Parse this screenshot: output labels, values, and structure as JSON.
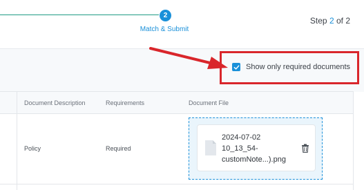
{
  "stepper": {
    "step_number": "2",
    "step_name": "Match & Submit",
    "counter_prefix": "Step ",
    "counter_current": "2",
    "counter_suffix": " of 2"
  },
  "filter": {
    "checked": true,
    "label": "Show only required documents"
  },
  "table": {
    "columns": [
      "Document Description",
      "Requirements",
      "Document File"
    ],
    "rows": [
      {
        "description": "Policy",
        "requirement": "Required",
        "file_lines": [
          "2024-07-02",
          "10_13_54-",
          "customNote...).png"
        ]
      }
    ]
  },
  "icons": {
    "step": "step-number-icon",
    "checkbox": "checkmark-icon",
    "file": "document-file-icon",
    "delete": "trash-icon",
    "annotation": "red-arrow-icon"
  },
  "colors": {
    "accent": "#1a90d9",
    "progress": "#1f9b84",
    "annotation": "#d9262b"
  }
}
